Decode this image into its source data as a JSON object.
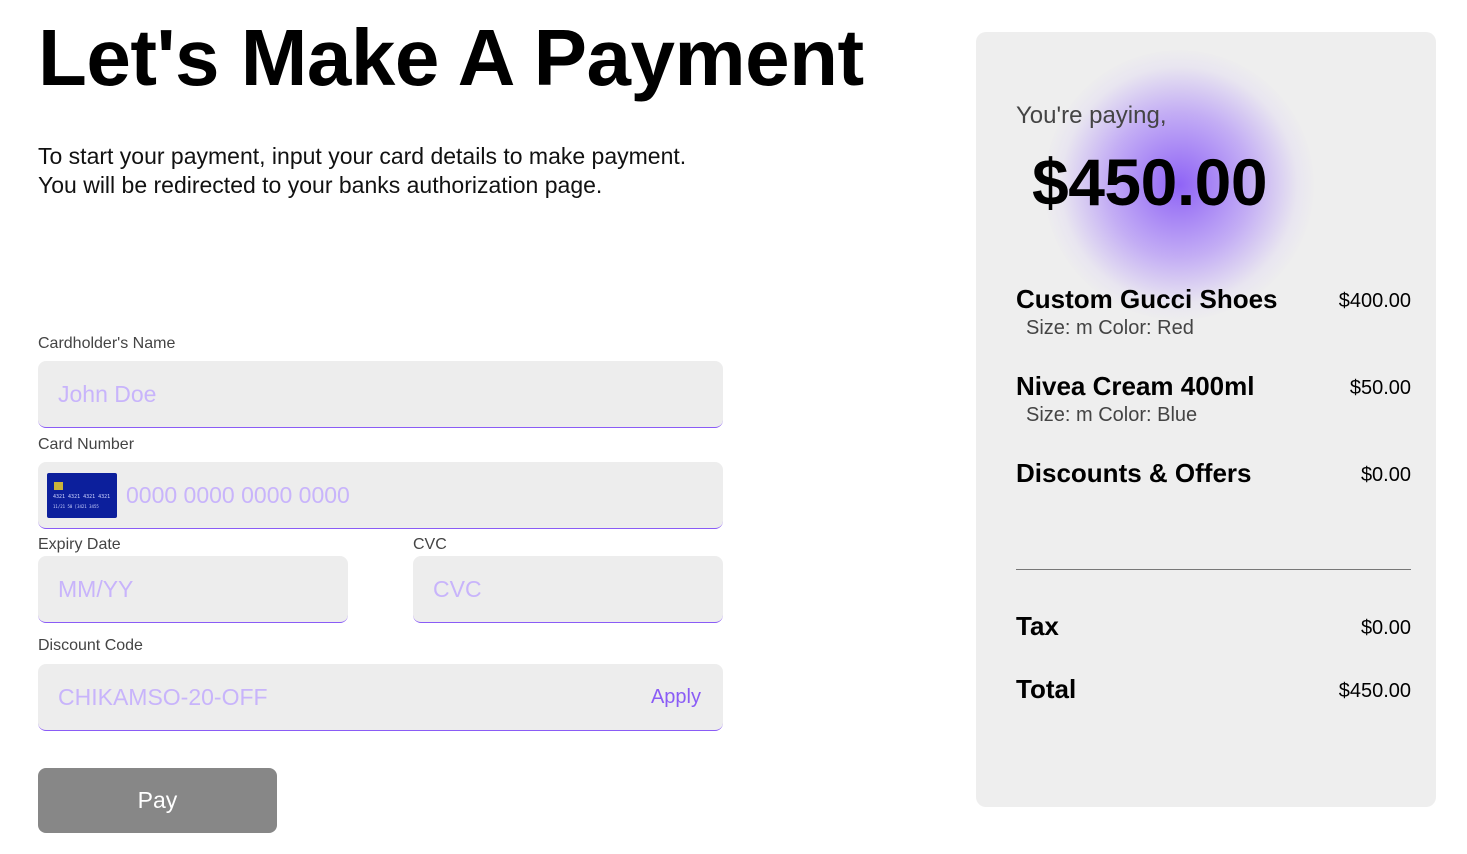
{
  "header": {
    "title": "Let's Make A Payment",
    "subtitle_line1": "To start your payment, input your card details to make payment.",
    "subtitle_line2": "You will be redirected to your banks authorization page."
  },
  "form": {
    "cardholder": {
      "label": "Cardholder's Name",
      "placeholder": "John Doe",
      "value": ""
    },
    "card_number": {
      "label": "Card Number",
      "placeholder": "0000 0000 0000 0000",
      "value": "",
      "icon": "credit-card-icon",
      "icon_text_1": "4321  4321  4321  4321",
      "icon_text_2": "11/21 50     [3421 3455"
    },
    "expiry": {
      "label": "Expiry Date",
      "placeholder": "MM/YY",
      "value": ""
    },
    "cvc": {
      "label": "CVC",
      "placeholder": "CVC",
      "value": ""
    },
    "discount": {
      "label": "Discount Code",
      "placeholder": "CHIKAMSO-20-OFF",
      "value": "",
      "apply_label": "Apply"
    },
    "pay_label": "Pay"
  },
  "summary": {
    "paying_label": "You're paying,",
    "amount": "$450.00",
    "items": [
      {
        "name": "Custom Gucci Shoes",
        "price": "$400.00",
        "meta": "Size: m Color: Red"
      },
      {
        "name": "Nivea Cream 400ml",
        "price": "$50.00",
        "meta": "Size: m Color: Blue"
      }
    ],
    "discounts": {
      "label": "Discounts & Offers",
      "value": "$0.00"
    },
    "tax": {
      "label": "Tax",
      "value": "$0.00"
    },
    "total": {
      "label": "Total",
      "value": "$450.00"
    }
  },
  "colors": {
    "accent": "#8a5cf6",
    "placeholder": "#c8b4fb",
    "field_bg": "#ededed",
    "panel_bg": "#eeeeee",
    "pay_button_bg": "#878787",
    "card_icon_bg": "#0c1f9c"
  }
}
